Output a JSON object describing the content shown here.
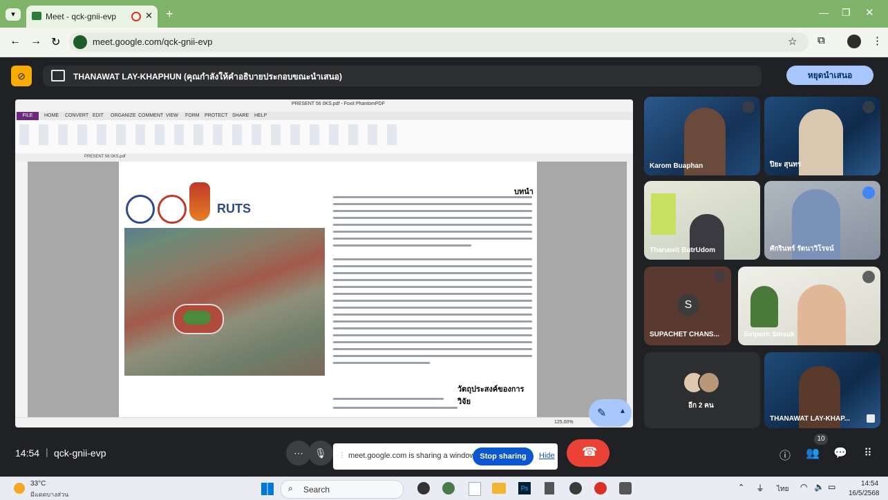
{
  "browser": {
    "tab_title": "Meet - qck-gnii-evp",
    "new_tab": "+",
    "url": "meet.google.com/qck-gnii-evp"
  },
  "meet": {
    "presenter_banner": "THANAWAT LAY-KHAPHUN (คุณกำลังให้คำอธิบายประกอบขณะนำเสนอ)",
    "stop_presenting_label": "หยุดนำเสนอ",
    "time": "14:54",
    "meeting_code": "qck-gnii-evp",
    "sharing_notice": "meet.google.com is sharing a window.",
    "stop_sharing_label": "Stop sharing",
    "hide_label": "Hide",
    "people_count": "10",
    "participants": [
      {
        "name": "Karom Buaphan"
      },
      {
        "name": "ปิยะ สุนทร"
      },
      {
        "name": "Thanawit ButrUdom"
      },
      {
        "name": "ศักรินทร์ รัตนาวิโรจน์"
      },
      {
        "name": "SUPACHET CHANS...",
        "initial": "S"
      },
      {
        "name": "Siriporn Sinsuk"
      },
      {
        "name": "อีก 2 คน"
      },
      {
        "name": "THANAWAT LAY-KHAP..."
      }
    ]
  },
  "shared_doc": {
    "window_title": "PRESENT 56 0KS.pdf - Foxit PhantomPDF",
    "ribbon_tabs": [
      "FILE",
      "HOME",
      "CONVERT",
      "EDIT",
      "ORGANIZE",
      "COMMENT",
      "VIEW",
      "FORM",
      "PROTECT",
      "SHARE",
      "HELP"
    ],
    "tab_label": "PRESENT 56 0KS.pdf",
    "logo_text": "RUTS",
    "heading_intro": "บทนำ",
    "heading_objectives": "วัตถุประสงค์ของการวิจัย",
    "zoom": "125.00%"
  },
  "taskbar": {
    "weather_temp": "33°C",
    "weather_desc": "มีแดดบางส่วน",
    "search_placeholder": "Search",
    "lang": "ไทย",
    "clock_time": "14:54",
    "clock_date": "16/5/2568"
  },
  "colors": {
    "chrome_tab_bar": "#7fb36a",
    "meet_bg": "#202124",
    "stop_presenting": "#a8c7fa",
    "stop_sharing": "#0b57d0",
    "end_call": "#ea4335"
  }
}
